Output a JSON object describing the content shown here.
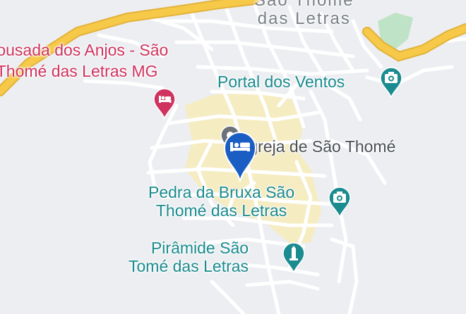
{
  "town": {
    "line1": "São Thomé",
    "line2": "das Letras"
  },
  "pois": {
    "pousada": {
      "line1": "Pousada dos Anjos - São",
      "line2": "Thomé das Letras MG",
      "icon": "hotel-icon"
    },
    "portal": {
      "label": "Portal dos Ventos",
      "icon": "camera-icon"
    },
    "igreja": {
      "label": "Igreja de São Thomé",
      "icon": "place-of-worship-icon"
    },
    "pedra": {
      "line1": "Pedra da Bruxa São",
      "line2": "Thomé das Letras",
      "icon": "camera-icon"
    },
    "piramide": {
      "line1": "Pirâmide São",
      "line2": "Tomé das Letras",
      "icon": "monument-icon"
    }
  },
  "selected_marker": {
    "icon": "hotel-icon"
  },
  "colors": {
    "background": "#eceef1",
    "road": "#ffffff",
    "highway": "#f7c948",
    "highway_outline": "#e2b23a",
    "town_center": "#f5ecc2",
    "park": "#bfe3c6",
    "pink_poi": "#d0335f",
    "teal_poi": "#1a8b8f",
    "marker": "#1a5ec4"
  }
}
